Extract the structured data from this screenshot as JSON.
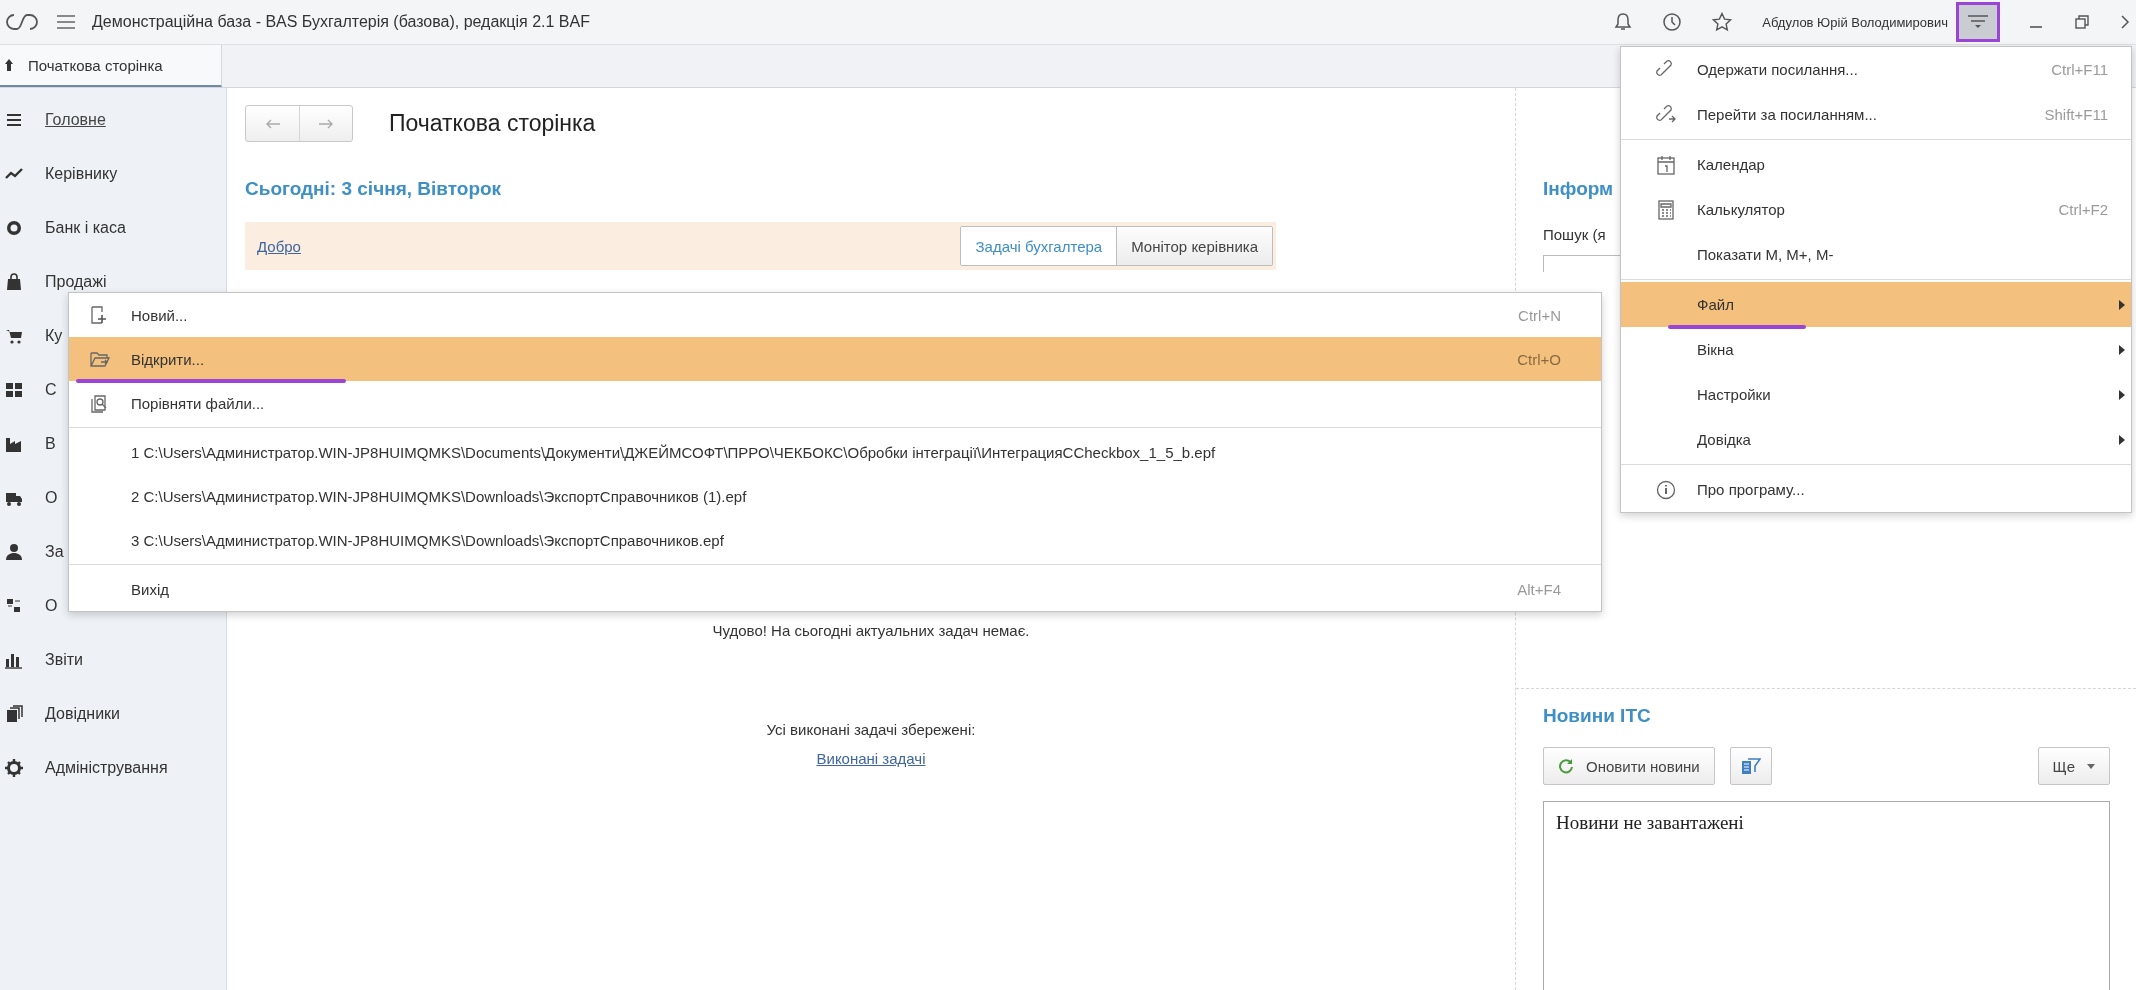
{
  "title_bar": {
    "title": "Демонстраційна база - BAS Бухгалтерія (базова), редакція 2.1 BAF",
    "user_name": "Абдулов Юрій Володимирович",
    "main_menu_button": {
      "pressed": true,
      "marked": true
    }
  },
  "tabs": [
    {
      "label": "Початкова сторінка",
      "selected": true
    }
  ],
  "sidebar": {
    "items": [
      {
        "label": "Головне",
        "selected": true
      },
      {
        "label": "Керівнику",
        "selected": false
      },
      {
        "label": "Банк і каса",
        "selected": false
      },
      {
        "label": "Продажі",
        "selected": false
      },
      {
        "label": "Ку",
        "selected": false
      },
      {
        "label": "С",
        "selected": false
      },
      {
        "label": "В",
        "selected": false
      },
      {
        "label": "О",
        "selected": false
      },
      {
        "label": "За",
        "selected": false
      },
      {
        "label": "О",
        "selected": false
      },
      {
        "label": "Звіти",
        "selected": false
      },
      {
        "label": "Довідники",
        "selected": false
      },
      {
        "label": "Адміністрування",
        "selected": false
      }
    ]
  },
  "page": {
    "title": "Початкова сторінка",
    "today": "Сьогодні: 3 січня, Вівторок",
    "greeting_link": "Добро",
    "view_switch": [
      {
        "label": "Задачі бухгалтера",
        "selected": true
      },
      {
        "label": "Монітор керівника",
        "selected": false
      }
    ],
    "empty_message": "Чудово! На сьогодні актуальних задач немає.",
    "saved_note": "Усі виконані задачі збережені:",
    "done_link": "Виконані задачі"
  },
  "info_panel": {
    "title": "Інформ",
    "search_label": "Пошук (я"
  },
  "news": {
    "title": "Новини ІТС",
    "refresh_button": "Оновити новини",
    "more_button": "Ще",
    "content": "Новини не завантажені"
  },
  "main_menu": {
    "items": [
      {
        "kind": "item",
        "label": "Одержати посилання...",
        "shortcut": "Ctrl+F11",
        "selected": false
      },
      {
        "kind": "item",
        "label": "Перейти за посиланням...",
        "shortcut": "Shift+F11",
        "selected": false
      },
      {
        "kind": "separator"
      },
      {
        "kind": "item",
        "label": "Календар",
        "selected": false
      },
      {
        "kind": "item",
        "label": "Калькулятор",
        "shortcut": "Ctrl+F2",
        "selected": false
      },
      {
        "kind": "item",
        "label": "Показати M, M+, M-",
        "selected": false
      },
      {
        "kind": "separator"
      },
      {
        "kind": "item",
        "label": "Файл",
        "submenu": true,
        "selected": true,
        "marked": true
      },
      {
        "kind": "item",
        "label": "Вікна",
        "submenu": true,
        "selected": false
      },
      {
        "kind": "item",
        "label": "Настройки",
        "submenu": true,
        "selected": false
      },
      {
        "kind": "item",
        "label": "Довідка",
        "submenu": true,
        "selected": false
      },
      {
        "kind": "separator"
      },
      {
        "kind": "item",
        "label": "Про програму...",
        "selected": false
      }
    ]
  },
  "file_menu": {
    "items": [
      {
        "kind": "item",
        "label": "Новий...",
        "shortcut": "Ctrl+N",
        "selected": false
      },
      {
        "kind": "item",
        "label": "Відкрити...",
        "shortcut": "Ctrl+O",
        "selected": true,
        "marked": true
      },
      {
        "kind": "item",
        "label": "Порівняти файли...",
        "selected": false
      },
      {
        "kind": "separator"
      },
      {
        "kind": "item",
        "label": "1 C:\\Users\\Администратор.WIN-JP8HUIMQMKS\\Documents\\Документи\\ДЖЕЙМСОФТ\\ПРРО\\ЧЕКБОКС\\Обробки інтеграції\\ИнтеграцияCCheckbox_1_5_b.epf",
        "selected": false
      },
      {
        "kind": "item",
        "label": "2 C:\\Users\\Администратор.WIN-JP8HUIMQMKS\\Downloads\\ЭкспортСправочников (1).epf",
        "selected": false
      },
      {
        "kind": "item",
        "label": "3 C:\\Users\\Администратор.WIN-JP8HUIMQMKS\\Downloads\\ЭкспортСправочников.epf",
        "selected": false
      },
      {
        "kind": "separator"
      },
      {
        "kind": "item",
        "label": "Вихід",
        "shortcut": "Alt+F4",
        "selected": false
      }
    ]
  }
}
